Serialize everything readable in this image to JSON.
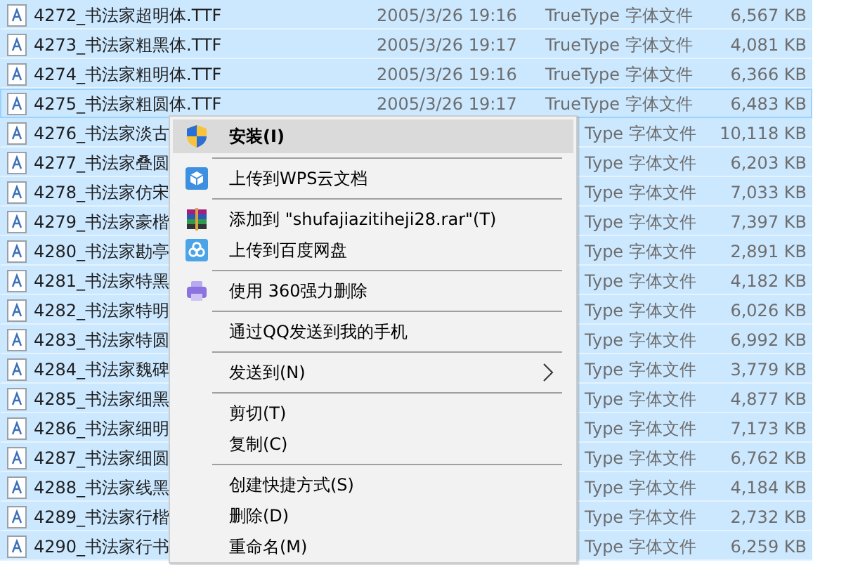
{
  "files": [
    {
      "name": "4272_书法家超明体.TTF",
      "date": "2005/3/26 19:16",
      "type": "TrueType 字体文件",
      "size": "6,567 KB",
      "selected": true,
      "focused": false
    },
    {
      "name": "4273_书法家粗黑体.TTF",
      "date": "2005/3/26 19:17",
      "type": "TrueType 字体文件",
      "size": "4,081 KB",
      "selected": true,
      "focused": false
    },
    {
      "name": "4274_书法家粗明体.TTF",
      "date": "2005/3/26 19:16",
      "type": "TrueType 字体文件",
      "size": "6,366 KB",
      "selected": true,
      "focused": false
    },
    {
      "name": "4275_书法家粗圆体.TTF",
      "date": "2005/3/26 19:17",
      "type": "TrueType 字体文件",
      "size": "6,483 KB",
      "selected": true,
      "focused": true
    },
    {
      "name": "4276_书法家淡古",
      "type": "Type 字体文件",
      "size": "10,118 KB",
      "selected": true,
      "focused": false
    },
    {
      "name": "4277_书法家叠圆",
      "type": "Type 字体文件",
      "size": "6,203 KB",
      "selected": true,
      "focused": false
    },
    {
      "name": "4278_书法家仿宋",
      "type": "Type 字体文件",
      "size": "7,033 KB",
      "selected": true,
      "focused": false
    },
    {
      "name": "4279_书法家豪楷",
      "type": "Type 字体文件",
      "size": "7,397 KB",
      "selected": true,
      "focused": false
    },
    {
      "name": "4280_书法家勘亭",
      "type": "Type 字体文件",
      "size": "2,891 KB",
      "selected": true,
      "focused": false
    },
    {
      "name": "4281_书法家特黑",
      "type": "Type 字体文件",
      "size": "4,182 KB",
      "selected": true,
      "focused": false
    },
    {
      "name": "4282_书法家特明",
      "type": "Type 字体文件",
      "size": "6,026 KB",
      "selected": true,
      "focused": false
    },
    {
      "name": "4283_书法家特圆",
      "type": "Type 字体文件",
      "size": "6,992 KB",
      "selected": true,
      "focused": false
    },
    {
      "name": "4284_书法家魏碑",
      "type": "Type 字体文件",
      "size": "3,779 KB",
      "selected": true,
      "focused": false
    },
    {
      "name": "4285_书法家细黑",
      "type": "Type 字体文件",
      "size": "4,877 KB",
      "selected": true,
      "focused": false
    },
    {
      "name": "4286_书法家细明",
      "type": "Type 字体文件",
      "size": "7,173 KB",
      "selected": true,
      "focused": false
    },
    {
      "name": "4287_书法家细圆",
      "type": "Type 字体文件",
      "size": "6,762 KB",
      "selected": true,
      "focused": false
    },
    {
      "name": "4288_书法家线黑",
      "type": "Type 字体文件",
      "size": "4,184 KB",
      "selected": true,
      "focused": false
    },
    {
      "name": "4289_书法家行楷",
      "type": "Type 字体文件",
      "size": "2,732 KB",
      "selected": true,
      "focused": false
    },
    {
      "name": "4290_书法家行书",
      "type": "Type 字体文件",
      "size": "6,259 KB",
      "selected": true,
      "focused": false
    }
  ],
  "context_menu": [
    {
      "kind": "shield",
      "label": "安装(I)",
      "default": true,
      "highlighted": true
    },
    {
      "kind": "separator"
    },
    {
      "kind": "cube",
      "label": "上传到WPS云文档",
      "default": false,
      "highlighted": false
    },
    {
      "kind": "separator"
    },
    {
      "kind": "archive",
      "label": "添加到 \"shufajiazitiheji28.rar\"(T)",
      "default": false,
      "highlighted": false
    },
    {
      "kind": "cloud",
      "label": "上传到百度网盘",
      "default": false,
      "highlighted": false
    },
    {
      "kind": "separator"
    },
    {
      "kind": "eraser",
      "label": "使用 360强力删除",
      "default": false,
      "highlighted": false
    },
    {
      "kind": "separator"
    },
    {
      "kind": "plain",
      "label": "通过QQ发送到我的手机",
      "default": false,
      "highlighted": false
    },
    {
      "kind": "separator"
    },
    {
      "kind": "submenu",
      "label": "发送到(N)",
      "default": false,
      "highlighted": false
    },
    {
      "kind": "separator"
    },
    {
      "kind": "plain",
      "label": "剪切(T)",
      "default": false,
      "highlighted": false
    },
    {
      "kind": "plain",
      "label": "复制(C)",
      "default": false,
      "highlighted": false
    },
    {
      "kind": "separator"
    },
    {
      "kind": "plain",
      "label": "创建快捷方式(S)",
      "default": false,
      "highlighted": false
    },
    {
      "kind": "plain",
      "label": "删除(D)",
      "default": false,
      "highlighted": false
    },
    {
      "kind": "plain",
      "label": "重命名(M)",
      "default": false,
      "highlighted": false
    }
  ]
}
